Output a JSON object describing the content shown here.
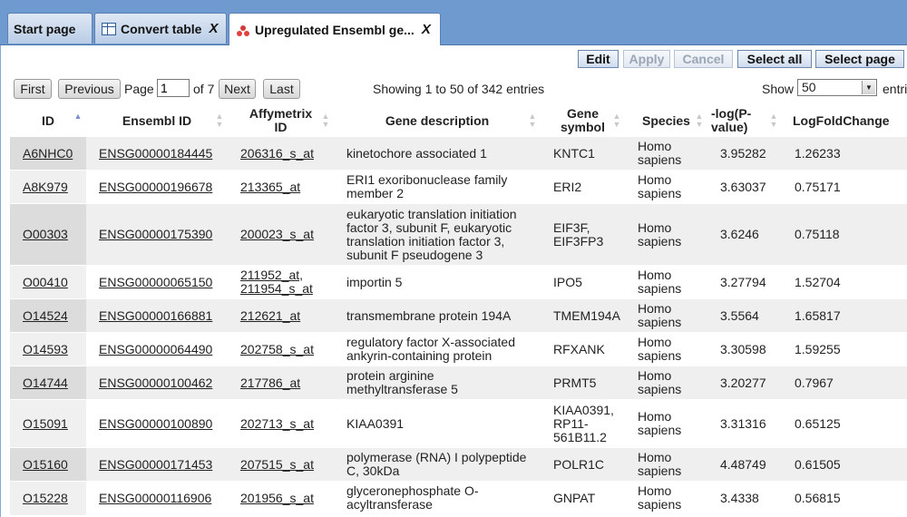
{
  "tabs": [
    {
      "label": "Start page",
      "closable": false
    },
    {
      "label": "Convert table",
      "close": "X",
      "icon": "table-icon"
    },
    {
      "label": "Upregulated Ensembl ge...",
      "close": "X",
      "icon": "molecule-icon"
    }
  ],
  "toolbar": {
    "edit": "Edit",
    "apply": "Apply",
    "cancel": "Cancel",
    "select_all": "Select all",
    "select_page": "Select page"
  },
  "pagination": {
    "first": "First",
    "previous": "Previous",
    "page_label": "Page",
    "page_value": "1",
    "of_label": "of 7",
    "next": "Next",
    "last": "Last"
  },
  "info": "Showing 1 to 50 of 342 entries",
  "show": {
    "label": "Show",
    "value": "50",
    "suffix": "entri"
  },
  "columns": [
    "ID",
    "Ensembl ID",
    "Affymetrix ID",
    "Gene description",
    "Gene symbol",
    "Species",
    "-log(P-value)",
    "LogFoldChange"
  ],
  "rows": [
    {
      "id": "A6NHC0",
      "ensembl": "ENSG00000184445",
      "affy": "206316_s_at",
      "desc": "kinetochore associated 1",
      "symbol": "KNTC1",
      "species": "Homo sapiens",
      "logp": "3.95282",
      "lfc": "1.26233"
    },
    {
      "id": "A8K979",
      "ensembl": "ENSG00000196678",
      "affy": "213365_at",
      "desc": "ERI1 exoribonuclease family member 2",
      "symbol": "ERI2",
      "species": "Homo sapiens",
      "logp": "3.63037",
      "lfc": "0.75171"
    },
    {
      "id": "O00303",
      "ensembl": "ENSG00000175390",
      "affy": "200023_s_at",
      "desc": "eukaryotic translation initiation factor 3, subunit F, eukaryotic translation initiation factor 3, subunit F pseudogene 3",
      "symbol": "EIF3F, EIF3FP3",
      "species": "Homo sapiens",
      "logp": "3.6246",
      "lfc": "0.75118"
    },
    {
      "id": "O00410",
      "ensembl": "ENSG00000065150",
      "affy": "211952_at, 211954_s_at",
      "desc": "importin 5",
      "symbol": "IPO5",
      "species": "Homo sapiens",
      "logp": "3.27794",
      "lfc": "1.52704"
    },
    {
      "id": "O14524",
      "ensembl": "ENSG00000166881",
      "affy": "212621_at",
      "desc": "transmembrane protein 194A",
      "symbol": "TMEM194A",
      "species": "Homo sapiens",
      "logp": "3.5564",
      "lfc": "1.65817"
    },
    {
      "id": "O14593",
      "ensembl": "ENSG00000064490",
      "affy": "202758_s_at",
      "desc": "regulatory factor X-associated ankyrin-containing protein",
      "symbol": "RFXANK",
      "species": "Homo sapiens",
      "logp": "3.30598",
      "lfc": "1.59255"
    },
    {
      "id": "O14744",
      "ensembl": "ENSG00000100462",
      "affy": "217786_at",
      "desc": "protein arginine methyltransferase 5",
      "symbol": "PRMT5",
      "species": "Homo sapiens",
      "logp": "3.20277",
      "lfc": "0.7967"
    },
    {
      "id": "O15091",
      "ensembl": "ENSG00000100890",
      "affy": "202713_s_at",
      "desc": "KIAA0391",
      "symbol": "KIAA0391, RP11-561B11.2",
      "species": "Homo sapiens",
      "logp": "3.31316",
      "lfc": "0.65125"
    },
    {
      "id": "O15160",
      "ensembl": "ENSG00000171453",
      "affy": "207515_s_at",
      "desc": "polymerase (RNA) I polypeptide C, 30kDa",
      "symbol": "POLR1C",
      "species": "Homo sapiens",
      "logp": "4.48749",
      "lfc": "0.61505"
    },
    {
      "id": "O15228",
      "ensembl": "ENSG00000116906",
      "affy": "201956_s_at",
      "desc": "glyceronephosphate O-acyltransferase",
      "symbol": "GNPAT",
      "species": "Homo sapiens",
      "logp": "3.4338",
      "lfc": "0.56815"
    }
  ]
}
